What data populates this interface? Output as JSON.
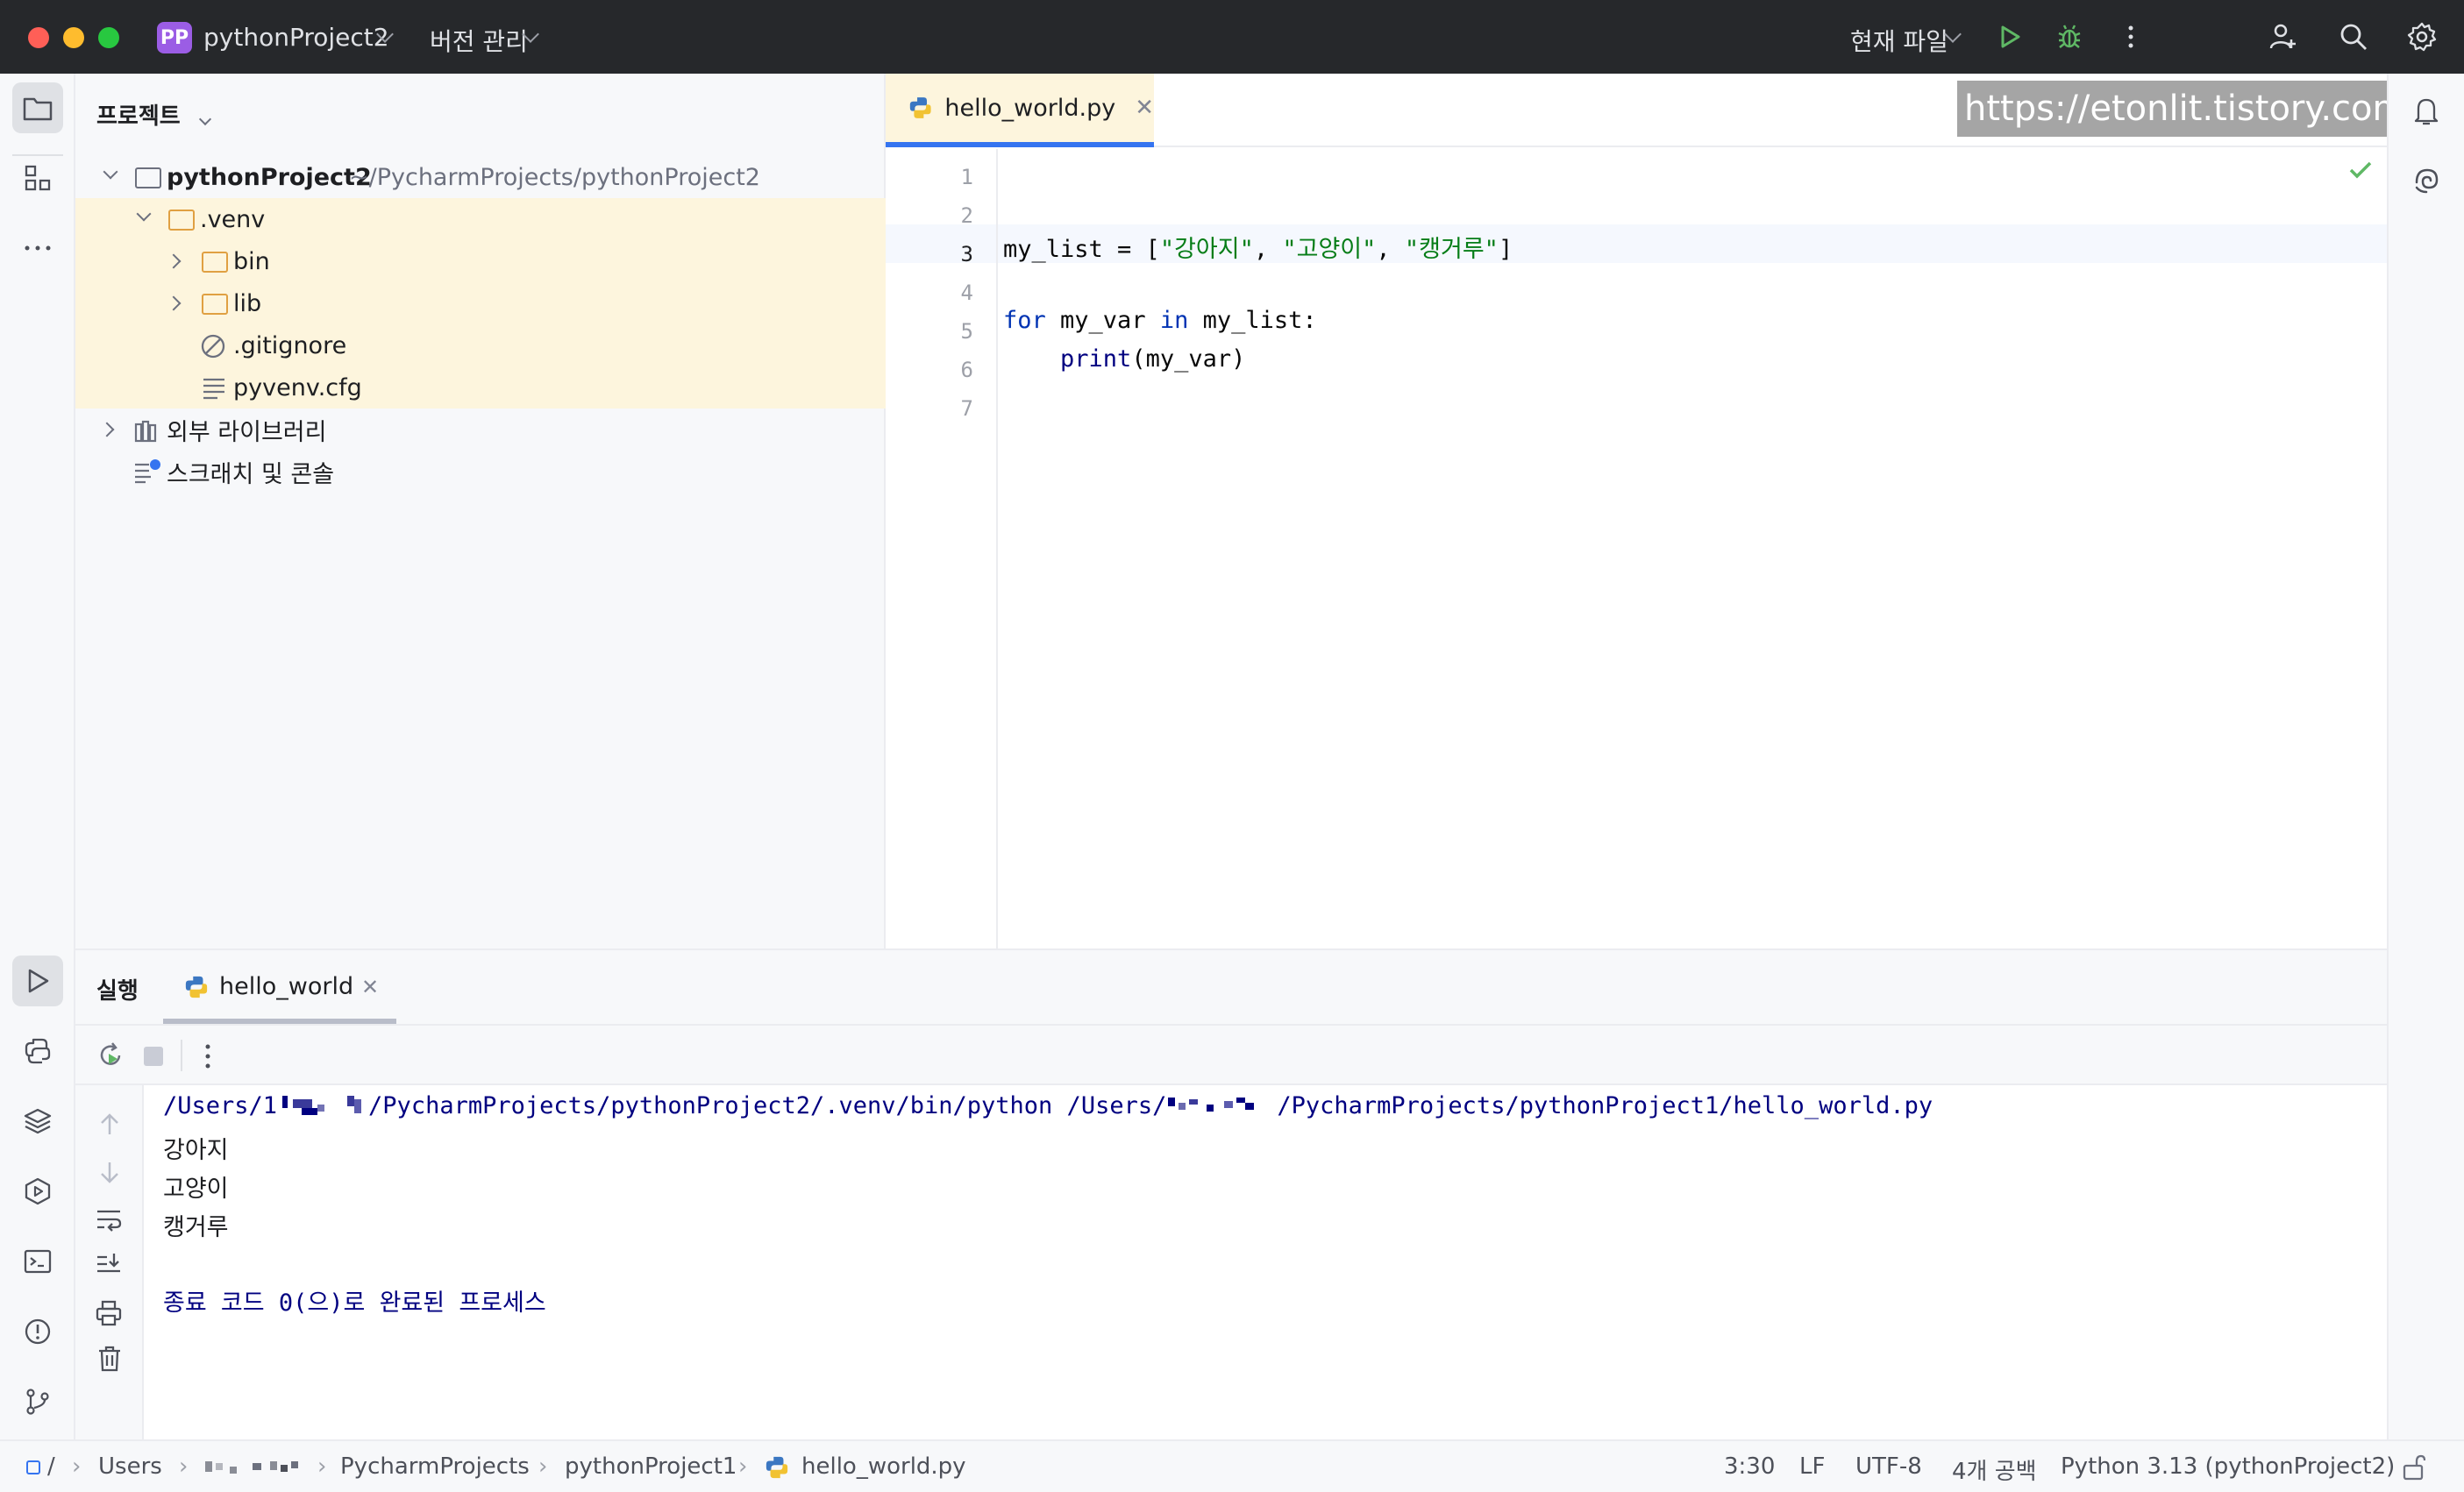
{
  "titlebar": {
    "project_badge": "PP",
    "project_name": "pythonProject2",
    "vcs_menu": "버전 관리",
    "run_config": "현재 파일",
    "icons": [
      "run-icon",
      "debug-icon",
      "more-icon",
      "add-user-icon",
      "search-icon",
      "settings-icon"
    ]
  },
  "project_panel": {
    "header": "프로젝트",
    "root_name": "pythonProject2",
    "root_path": "~/PycharmProjects/pythonProject2",
    "items": [
      {
        "label": ".venv"
      },
      {
        "label": "bin"
      },
      {
        "label": "lib"
      },
      {
        "label": ".gitignore"
      },
      {
        "label": "pyvenv.cfg"
      },
      {
        "label": "외부 라이브러리"
      },
      {
        "label": "스크래치 및 콘솔"
      }
    ]
  },
  "editor": {
    "tab_label": "hello_world.py",
    "watermark": "https://etonlit.tistory.com",
    "line_numbers": [
      "1",
      "2",
      "3",
      "4",
      "5",
      "6",
      "7"
    ],
    "code": {
      "l3_a": "my_list = [",
      "l3_s1": "\"강아지\"",
      "l3_c1": ", ",
      "l3_s2": "\"고양이\"",
      "l3_c2": ", ",
      "l3_s3": "\"캥거루\"",
      "l3_end": "]",
      "l5_for": "for",
      "l5_mid": " my_var ",
      "l5_in": "in",
      "l5_end": " my_list:",
      "l6_indent": "    ",
      "l6_print": "print",
      "l6_end": "(my_var)"
    }
  },
  "run_panel": {
    "title": "실행",
    "tab_label": "hello_world",
    "command_a": "/Users/1",
    "command_b": "/PycharmProjects/pythonProject2/.venv/bin/python /Users/",
    "command_c": "/PycharmProjects/pythonProject1/hello_world.py",
    "output": [
      "강아지",
      "고양이",
      "캥거루"
    ],
    "exit_message": "종료 코드 0(으)로 완료된 프로세스"
  },
  "statusbar": {
    "breadcrumb": [
      "Users",
      "PycharmProjects",
      "pythonProject1",
      "hello_world.py"
    ],
    "position": "3:30",
    "line_sep": "LF",
    "encoding": "UTF-8",
    "indent": "4개 공백",
    "interpreter": "Python 3.13 (pythonProject2)"
  },
  "colors": {
    "accent": "#3574f0",
    "keyword": "#0033b3",
    "string": "#067d17",
    "highlight": "#fdf5dd"
  }
}
